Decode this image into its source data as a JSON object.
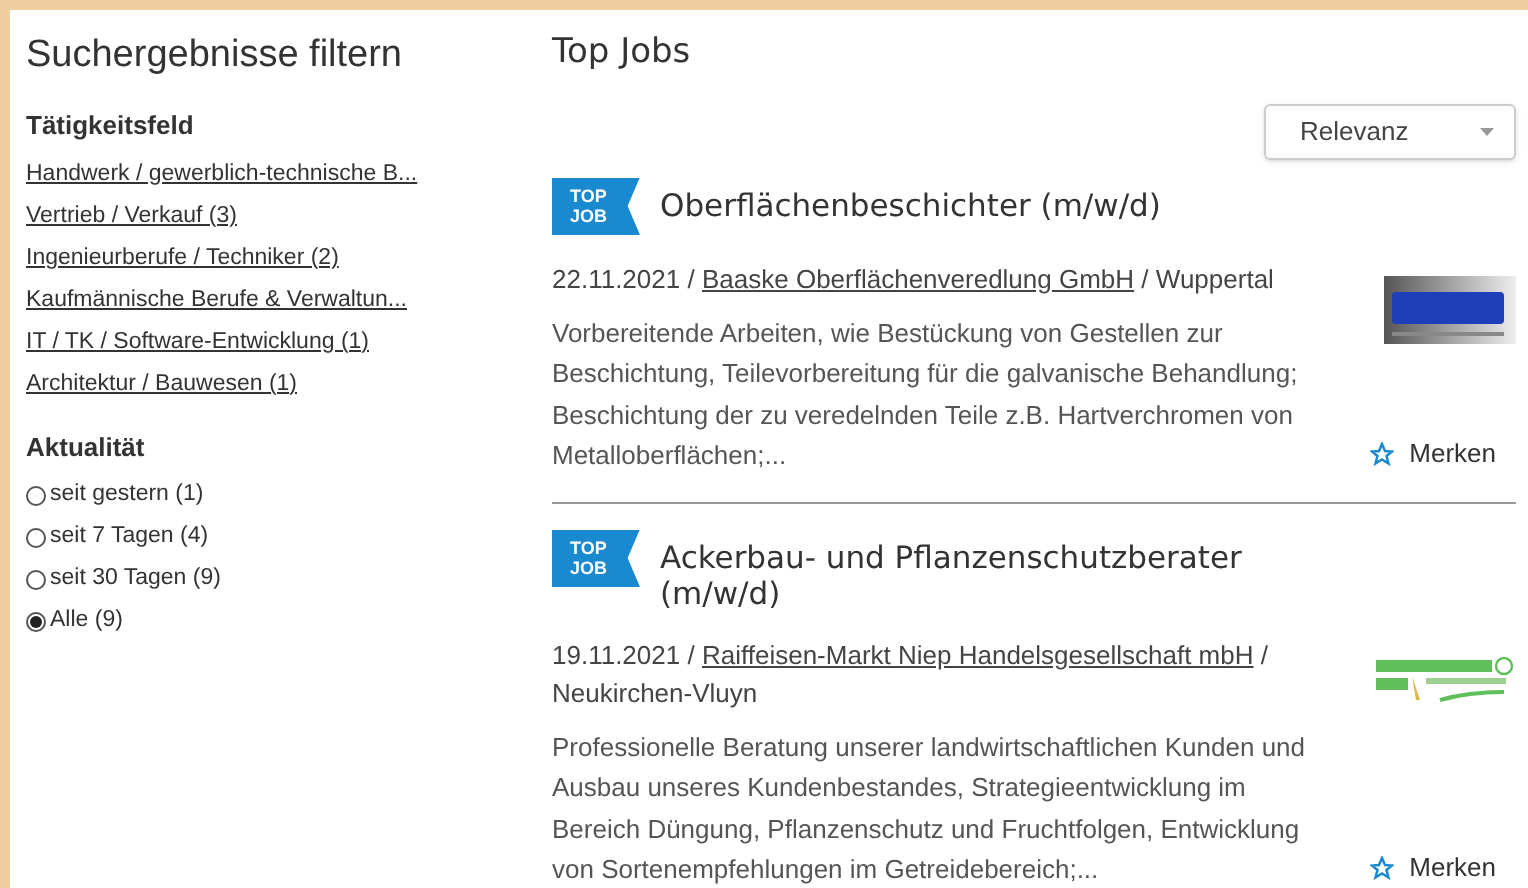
{
  "filter": {
    "title": "Suchergebnisse filtern",
    "field": {
      "heading": "Tätigkeitsfeld",
      "links": [
        "Handwerk / gewerblich-technische B...",
        "Vertrieb / Verkauf (3)",
        "Ingenieurberufe / Techniker (2)",
        "Kaufmännische Berufe & Verwaltun...",
        "IT / TK / Software-Entwicklung (1)",
        "Architektur / Bauwesen (1)"
      ]
    },
    "recency": {
      "heading": "Aktualität",
      "options": [
        {
          "label": "seit gestern (1)",
          "selected": false
        },
        {
          "label": "seit 7 Tagen (4)",
          "selected": false
        },
        {
          "label": "seit 30 Tagen (9)",
          "selected": false
        },
        {
          "label": "Alle (9)",
          "selected": true
        }
      ]
    }
  },
  "results": {
    "title": "Top Jobs",
    "sort": {
      "value": "Relevanz"
    },
    "jobs": [
      {
        "badge": [
          "TOP",
          "JOB"
        ],
        "title": "Oberflächenbeschichter (m/w/d)",
        "date": "22.11.2021",
        "company": "Baaske Oberflächenveredlung GmbH",
        "separator": "/",
        "location": "Wuppertal",
        "kind": "baaske",
        "description": "Vorbereitende Arbeiten, wie Bestückung von Gestellen zur Beschichtung, Teilevorbereitung für die galvanische Behandlung; Beschichtung der zu veredelnden Teile z.B. Hartverchromen von Metalloberflächen;...",
        "save": "Merken"
      },
      {
        "badge": [
          "TOP",
          "JOB"
        ],
        "title": "Ackerbau- und Pflanzenschutzberater (m/w/d)",
        "date": "19.11.2021",
        "company": "Raiffeisen-Markt Niep Handelsgesellschaft mbH",
        "separator": "/",
        "location": "Neukirchen-Vluyn",
        "kind": "raiffeisen",
        "description": "Professionelle Beratung unserer landwirtschaftlichen Kunden und Ausbau unseres Kundenbestandes, Strategieentwicklung im Bereich Düngung, Pflanzenschutz und Fruchtfolgen, Entwicklung von Sortenempfehlungen im Getreidebereich;...",
        "save": "Merken"
      }
    ]
  }
}
